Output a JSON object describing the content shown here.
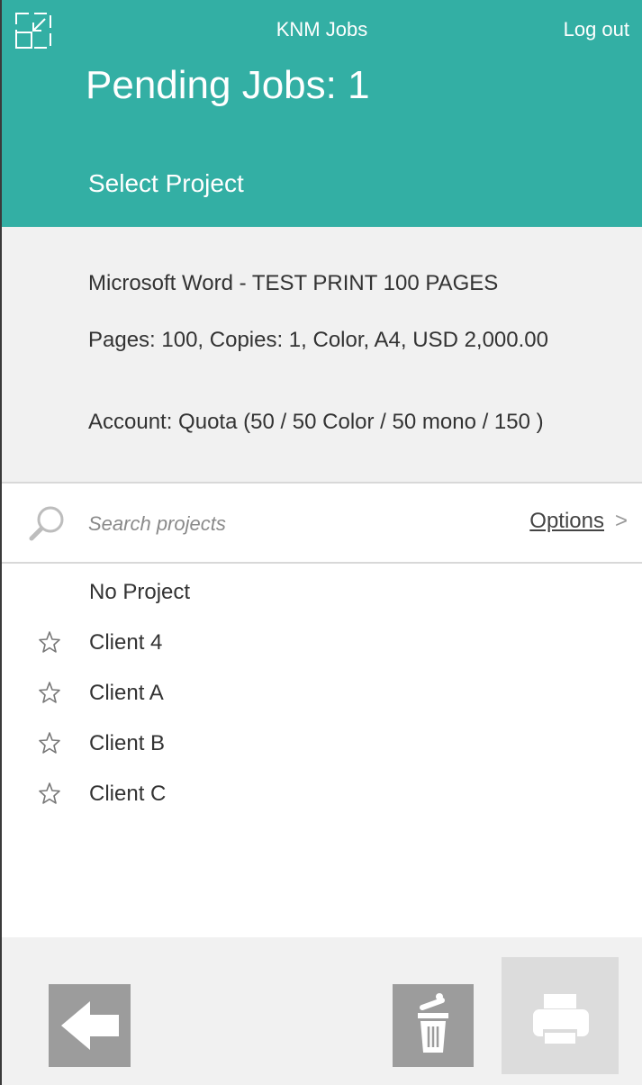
{
  "header": {
    "app_title": "KNM Jobs",
    "logout_label": "Log out",
    "pending_title": "Pending Jobs: 1",
    "section_title": "Select Project"
  },
  "job": {
    "title": "Microsoft Word - TEST PRINT 100 PAGES",
    "details": "Pages: 100, Copies: 1, Color, A4, USD 2,000.00",
    "account": "Account: Quota (50  / 50 Color / 50 mono / 150 )"
  },
  "search": {
    "placeholder": "Search projects",
    "options_label": "Options",
    "options_chevron": ">"
  },
  "projects": [
    {
      "label": "No Project",
      "starred": false
    },
    {
      "label": "Client 4",
      "starred": false
    },
    {
      "label": "Client A",
      "starred": false
    },
    {
      "label": "Client B",
      "starred": false
    },
    {
      "label": "Client C",
      "starred": false
    }
  ],
  "icons": {
    "collapse": "collapse-window-icon",
    "search": "magnifier-icon",
    "star": "star-outline-icon",
    "back": "arrow-left-icon",
    "trash": "trash-icon",
    "print": "printer-icon"
  },
  "colors": {
    "header_bg": "#33afa4",
    "info_bg": "#f1f1f1",
    "button_gray": "#9c9c9c",
    "button_disabled": "#dcdcdc"
  }
}
